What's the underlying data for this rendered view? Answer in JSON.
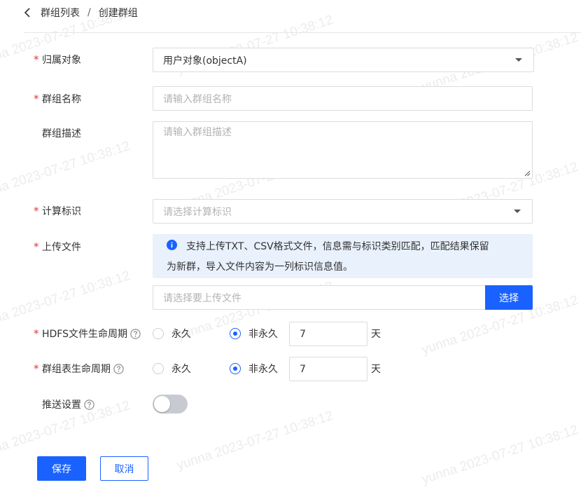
{
  "breadcrumb": {
    "parent": "群组列表",
    "separator": "/",
    "current": "创建群组"
  },
  "form": {
    "owner": {
      "label": "归属对象",
      "value": "用户对象(objectA)"
    },
    "name": {
      "label": "群组名称",
      "placeholder": "请输入群组名称"
    },
    "description": {
      "label": "群组描述",
      "placeholder": "请输入群组描述"
    },
    "calc_id": {
      "label": "计算标识",
      "placeholder": "请选择计算标识"
    },
    "upload": {
      "label": "上传文件",
      "notice_line1": "支持上传TXT、CSV格式文件，信息需与标识类别匹配，匹配结果保留",
      "notice_line2": "为新群，导入文件内容为一列标识信息值。",
      "placeholder": "请选择要上传文件",
      "button": "选择"
    },
    "hdfs_lifecycle": {
      "label": "HDFS文件生命周期",
      "option_permanent": "永久",
      "option_non_permanent": "非永久",
      "selected": "非永久",
      "value": "7",
      "unit": "天"
    },
    "table_lifecycle": {
      "label": "群组表生命周期",
      "option_permanent": "永久",
      "option_non_permanent": "非永久",
      "selected": "非永久",
      "value": "7",
      "unit": "天"
    },
    "push": {
      "label": "推送设置",
      "enabled": false
    }
  },
  "actions": {
    "save": "保存",
    "cancel": "取消"
  },
  "watermark": "yunna 2023-07-27 10:38:12",
  "colors": {
    "primary": "#1a62ff",
    "required": "#e0393e",
    "notice_bg": "#e9f1fd"
  }
}
